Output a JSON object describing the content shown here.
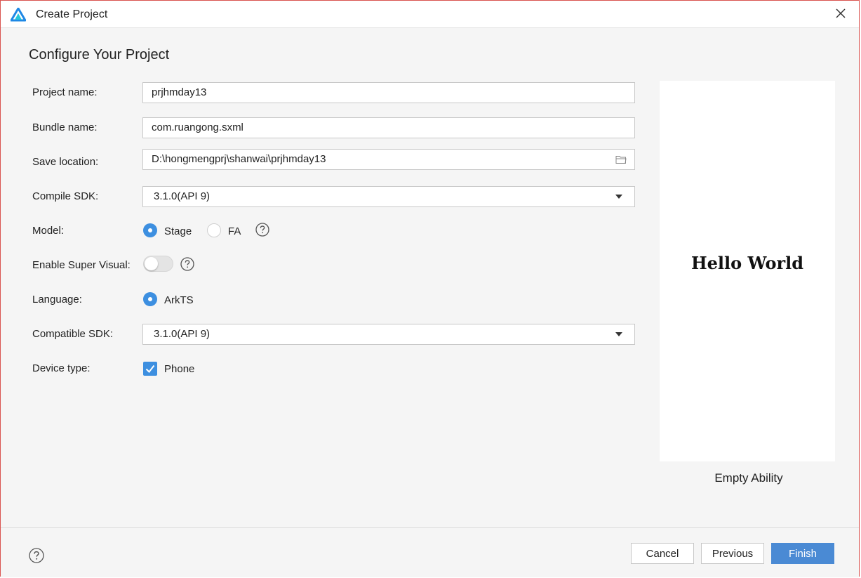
{
  "window": {
    "title": "Create Project",
    "heading": "Configure Your Project",
    "icons": {
      "app": "deveco-logo-icon",
      "close": "close-icon"
    }
  },
  "form": {
    "project_name": {
      "label": "Project name:",
      "value": "prjhmday13"
    },
    "bundle_name": {
      "label": "Bundle name:",
      "value": "com.ruangong.sxml"
    },
    "save_location": {
      "label": "Save location:",
      "value": "D:\\hongmengprj\\shanwai\\prjhmday13",
      "icon": "folder-icon"
    },
    "compile_sdk": {
      "label": "Compile SDK:",
      "value": "3.1.0(API 9)"
    },
    "model": {
      "label": "Model:",
      "options": [
        "Stage",
        "FA"
      ],
      "selected": "Stage"
    },
    "super_visual": {
      "label": "Enable Super Visual:",
      "enabled": false
    },
    "language": {
      "label": "Language:",
      "options": [
        "ArkTS"
      ],
      "selected": "ArkTS"
    },
    "compatible_sdk": {
      "label": "Compatible SDK:",
      "value": "3.1.0(API 9)"
    },
    "device_type": {
      "label": "Device type:",
      "options": [
        "Phone"
      ],
      "checked": [
        "Phone"
      ]
    }
  },
  "preview": {
    "text": "Hello World",
    "template_name": "Empty Ability"
  },
  "footer": {
    "cancel": "Cancel",
    "previous": "Previous",
    "finish": "Finish"
  },
  "colors": {
    "accent": "#3d8fe0",
    "primary_button": "#4a8ad4",
    "window_border": "#d9534f"
  }
}
